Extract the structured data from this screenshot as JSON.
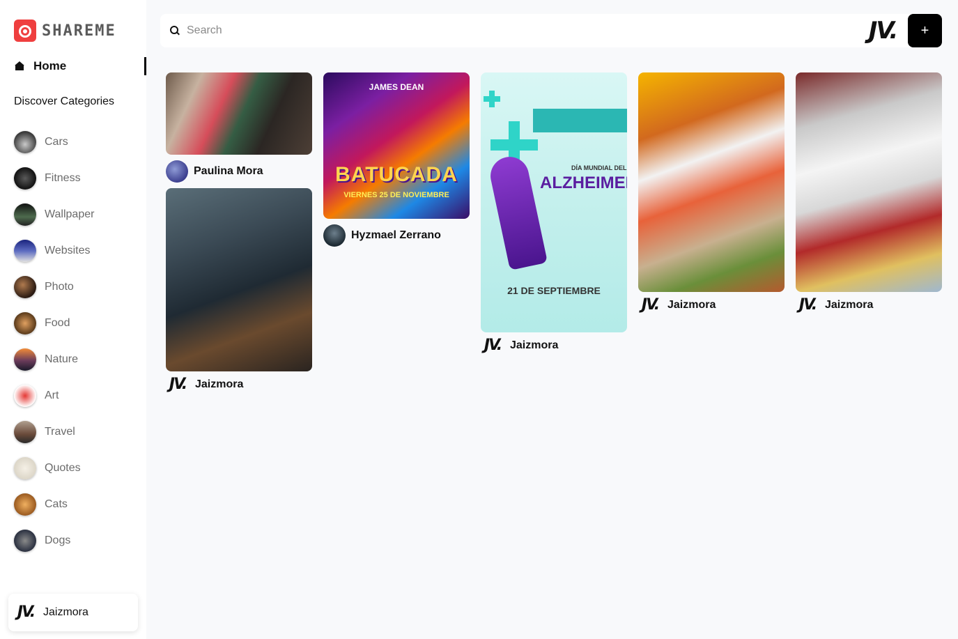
{
  "app": {
    "logo_text": "SHAREME"
  },
  "sidebar": {
    "home_label": "Home",
    "categories_heading": "Discover Categories",
    "categories": [
      {
        "label": "Cars"
      },
      {
        "label": "Fitness"
      },
      {
        "label": "Wallpaper"
      },
      {
        "label": "Websites"
      },
      {
        "label": "Photo"
      },
      {
        "label": "Food"
      },
      {
        "label": "Nature"
      },
      {
        "label": "Art"
      },
      {
        "label": "Travel"
      },
      {
        "label": "Quotes"
      },
      {
        "label": "Cats"
      },
      {
        "label": "Dogs"
      }
    ],
    "user": {
      "name": "Jaizmora",
      "avatar": "JV."
    }
  },
  "header": {
    "search": {
      "placeholder": "Search",
      "value": ""
    },
    "user_avatar": "JV.",
    "add_label": "+"
  },
  "pins": [
    {
      "user": "Paulina Mora"
    },
    {
      "user": "Jaizmora"
    },
    {
      "user": "Hyzmael Zerrano",
      "poster": {
        "top": "JAMES DEAN",
        "title": "BATUCADA",
        "sub": "VIERNES 25 DE NOVIEMBRE"
      }
    },
    {
      "user": "Jaizmora",
      "poster": {
        "small": "DÍA MUNDIAL DEL",
        "title": "ALZHEIMER",
        "date": "21 DE SEPTIEMBRE"
      }
    },
    {
      "user": "Jaizmora"
    },
    {
      "user": "Jaizmora"
    }
  ],
  "colors": {
    "accent": "#ef3f3f",
    "add_button": "#000000",
    "alzheimer_ribbon": "#6a2bb5"
  }
}
